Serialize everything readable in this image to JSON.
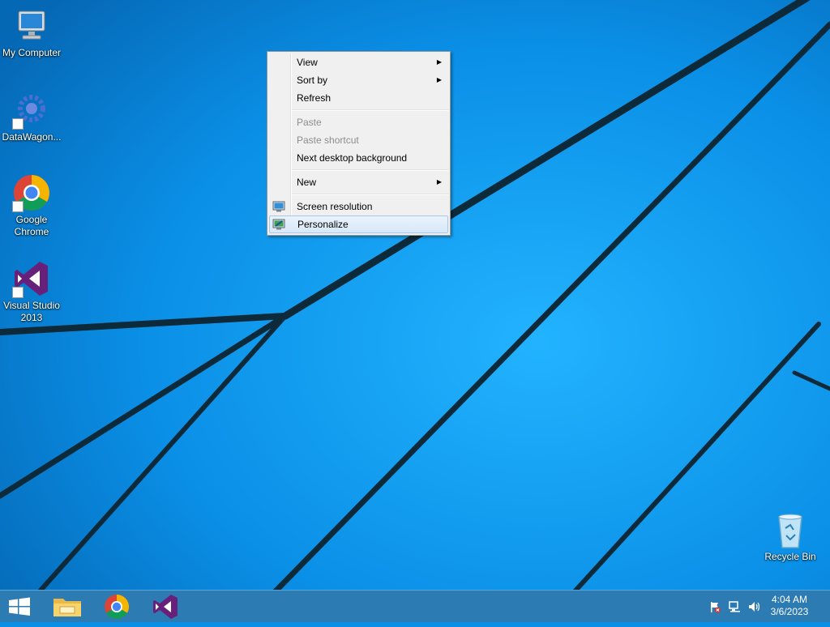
{
  "desktop": {
    "icons": [
      {
        "label": "My Computer",
        "icon": "computer-icon"
      },
      {
        "label": "DataWagon...",
        "icon": "datawagon-icon"
      },
      {
        "label": "Google Chrome",
        "icon": "chrome-icon"
      },
      {
        "label": "Visual Studio 2013",
        "icon": "visual-studio-icon"
      },
      {
        "label": "Recycle Bin",
        "icon": "recycle-bin-icon"
      }
    ]
  },
  "context_menu": {
    "items": [
      {
        "label": "View",
        "has_submenu": true
      },
      {
        "label": "Sort by",
        "has_submenu": true
      },
      {
        "label": "Refresh"
      },
      {
        "label": "Paste",
        "disabled": true
      },
      {
        "label": "Paste shortcut",
        "disabled": true
      },
      {
        "label": "Next desktop background"
      },
      {
        "label": "New",
        "has_submenu": true
      },
      {
        "label": "Screen resolution",
        "icon": "monitor-icon"
      },
      {
        "label": "Personalize",
        "icon": "personalize-icon",
        "highlighted": true
      }
    ],
    "submenu_arrow": "▶"
  },
  "taskbar": {
    "pinned": [
      "start-button",
      "file-explorer-icon",
      "chrome-icon",
      "visual-studio-icon"
    ],
    "tray_icons": [
      "action-center-flag-icon",
      "network-icon",
      "volume-icon"
    ],
    "clock": {
      "time": "4:04 AM",
      "date": "3/6/2023"
    }
  },
  "colors": {
    "wallpaper": "#0a8fe6",
    "menu_bg": "#f0f0f0",
    "menu_highlight": "#d8e8f8",
    "taskbar": "#2d7bb3"
  }
}
